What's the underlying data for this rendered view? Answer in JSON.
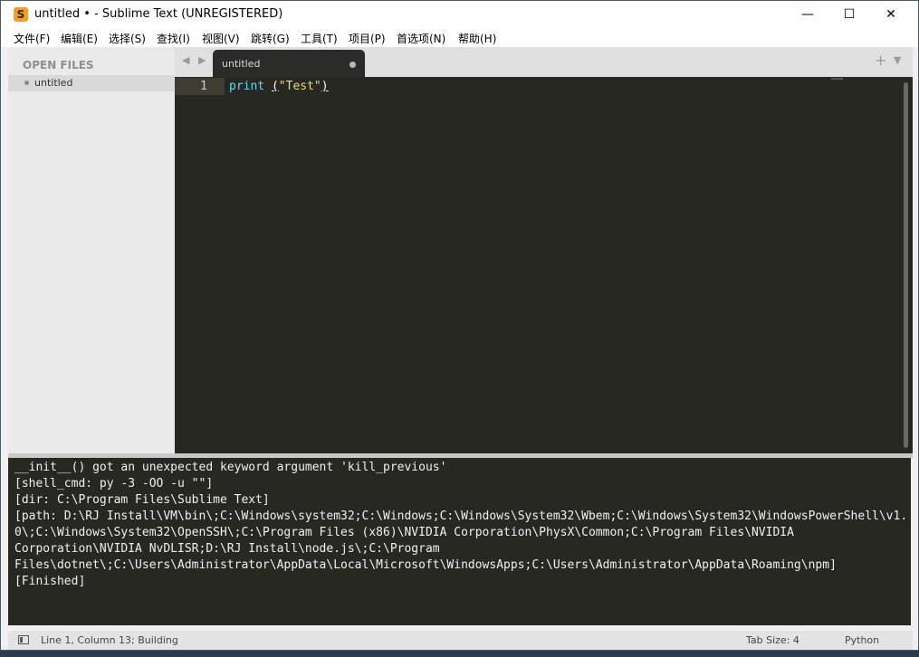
{
  "window": {
    "title": "untitled • - Sublime Text (UNREGISTERED)",
    "app_icon_glyph": "S",
    "minimize_glyph": "—",
    "maximize_glyph": "☐",
    "close_glyph": "✕"
  },
  "menu": {
    "items": [
      {
        "label": "文件(F)"
      },
      {
        "label": "编辑(E)"
      },
      {
        "label": "选择(S)"
      },
      {
        "label": "查找(I)"
      },
      {
        "label": "视图(V)"
      },
      {
        "label": "跳转(G)"
      },
      {
        "label": "工具(T)"
      },
      {
        "label": "项目(P)"
      },
      {
        "label": "首选项(N)"
      },
      {
        "label": "帮助(H)"
      }
    ]
  },
  "sidebar": {
    "header": "OPEN FILES",
    "items": [
      {
        "label": "untitled",
        "icon": "modified-dot-icon"
      }
    ]
  },
  "tabs": {
    "nav_glyph": "◀ ▶",
    "items": [
      {
        "label": "untitled",
        "modified": true,
        "icon": "modified-dot-icon"
      }
    ],
    "add_glyph": "+",
    "menu_glyph": "▼"
  },
  "editor": {
    "lines": [
      {
        "number": "1",
        "tokens": {
          "func": "print",
          "space": " ",
          "open_paren": "(",
          "string": "\"Test\"",
          "close_paren": ")"
        }
      }
    ],
    "colors": {
      "background": "#272822",
      "function": "#66d9ef",
      "string": "#e6db74",
      "punctuation": "#f8f8f2"
    }
  },
  "output_panel": {
    "lines": [
      "__init__() got an unexpected keyword argument 'kill_previous'",
      "[shell_cmd: py -3 -OO -u \"\"]",
      "[dir: C:\\Program Files\\Sublime Text]",
      "[path: D:\\RJ Install\\VM\\bin\\;C:\\Windows\\system32;C:\\Windows;C:\\Windows\\System32\\Wbem;C:\\Windows\\System32\\WindowsPowerShell\\v1.0\\;C:\\Windows\\System32\\OpenSSH\\;C:\\Program Files (x86)\\NVIDIA Corporation\\PhysX\\Common;C:\\Program Files\\NVIDIA",
      "Corporation\\NVIDIA NvDLISR;D:\\RJ Install\\node.js\\;C:\\Program",
      "Files\\dotnet\\;C:\\Users\\Administrator\\AppData\\Local\\Microsoft\\WindowsApps;C:\\Users\\Administrator\\AppData\\Roaming\\npm]",
      "[Finished]"
    ]
  },
  "statusbar": {
    "position": "Line 1, Column 13; Building",
    "tab_size": "Tab Size: 4",
    "syntax": "Python"
  }
}
